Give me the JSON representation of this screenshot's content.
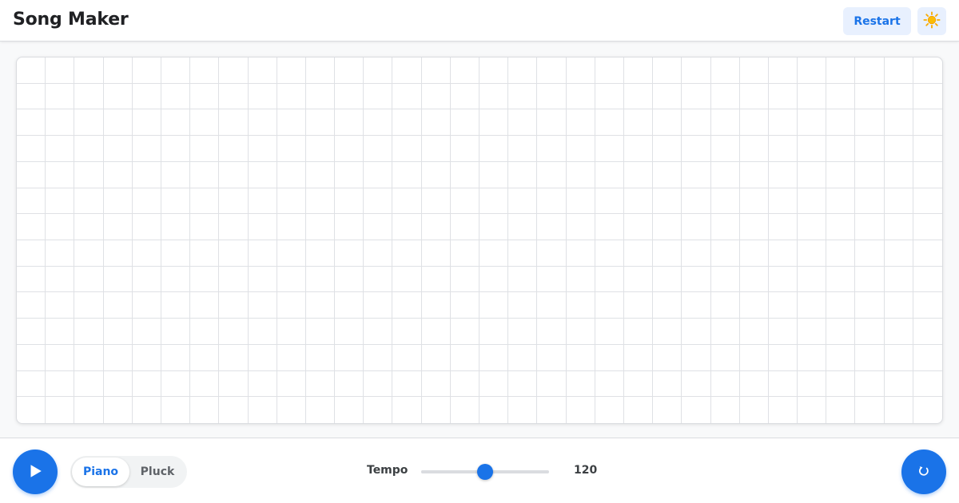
{
  "app": {
    "title": "Song Maker"
  },
  "header": {
    "restart_label": "Restart",
    "theme_icon": "sun-icon"
  },
  "grid": {
    "columns": 32,
    "rows": 14,
    "active_cells": []
  },
  "footer": {
    "play_icon": "play-icon",
    "instruments": [
      {
        "label": "Piano",
        "selected": true
      },
      {
        "label": "Pluck",
        "selected": false
      }
    ],
    "tempo": {
      "label": "Tempo",
      "value": "120",
      "level_fraction": 0.5
    },
    "loop_icon": "loop-icon"
  },
  "colors": {
    "accent": "#1a73e8",
    "accent_light": "#e8f0fe",
    "grid_line": "#dfe1e5",
    "sun": "#f9ab00"
  }
}
